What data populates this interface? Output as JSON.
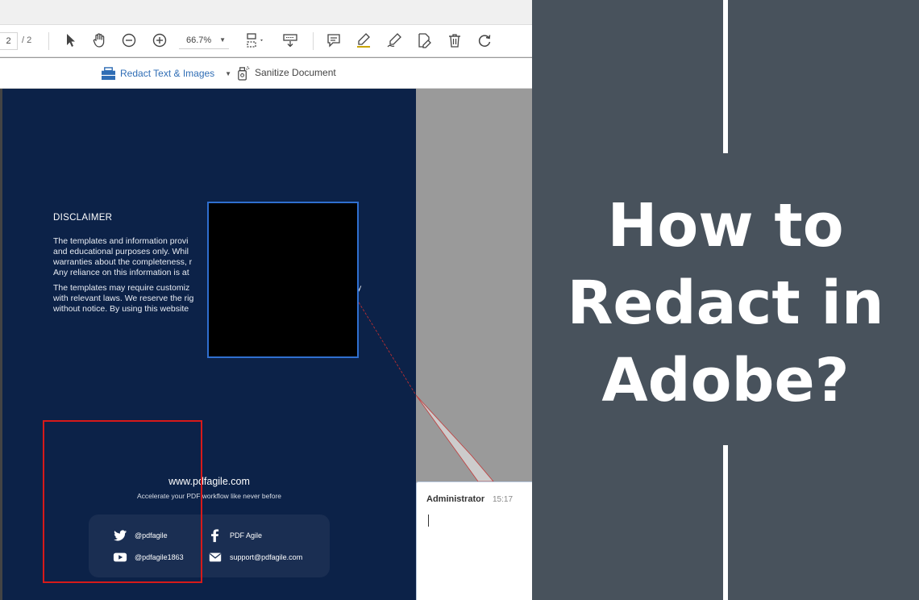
{
  "toolbar": {
    "page_current": "2",
    "page_total": "/ 2",
    "zoom_value": "66.7%",
    "icons": [
      "select-cursor-icon",
      "hand-tool-icon",
      "zoom-out-icon",
      "zoom-in-icon",
      "fit-page-icon",
      "scroll-mode-icon",
      "comment-icon",
      "highlight-icon",
      "draw-icon",
      "edit-text-icon",
      "delete-icon",
      "rotate-icon"
    ]
  },
  "redact_bar": {
    "redact_label": "Redact Text & Images",
    "sanitize_label": "Sanitize Document"
  },
  "document": {
    "disclaimer_title": "DISCLAIMER",
    "disclaimer_p1": "The templates and information provi\nand educational purposes only. Whil\nwarranties about the completeness, r\nAny reliance on this information is at",
    "disclaimer_p2": "The templates may require customiz\nwith relevant laws. We reserve the rig\nwithout notice. By using this website",
    "fragment_1": "y",
    "website": "www.pdfagile.com",
    "tagline": "Accelerate your PDF workflow like never before",
    "social": {
      "twitter": "@pdfagile",
      "facebook": "PDF Agile",
      "youtube": "@pdfagile1863",
      "email": "support@pdfagile.com"
    }
  },
  "comment": {
    "author": "Administrator",
    "time": "15:17"
  },
  "colors": {
    "page_bg": "#0c2248",
    "redact_accent": "#2f6db5",
    "mark_border": "#d71a1a",
    "panel_bg": "#48525c"
  },
  "headline": {
    "line1": "How to",
    "line2": "Redact in",
    "line3": "Adobe?"
  }
}
